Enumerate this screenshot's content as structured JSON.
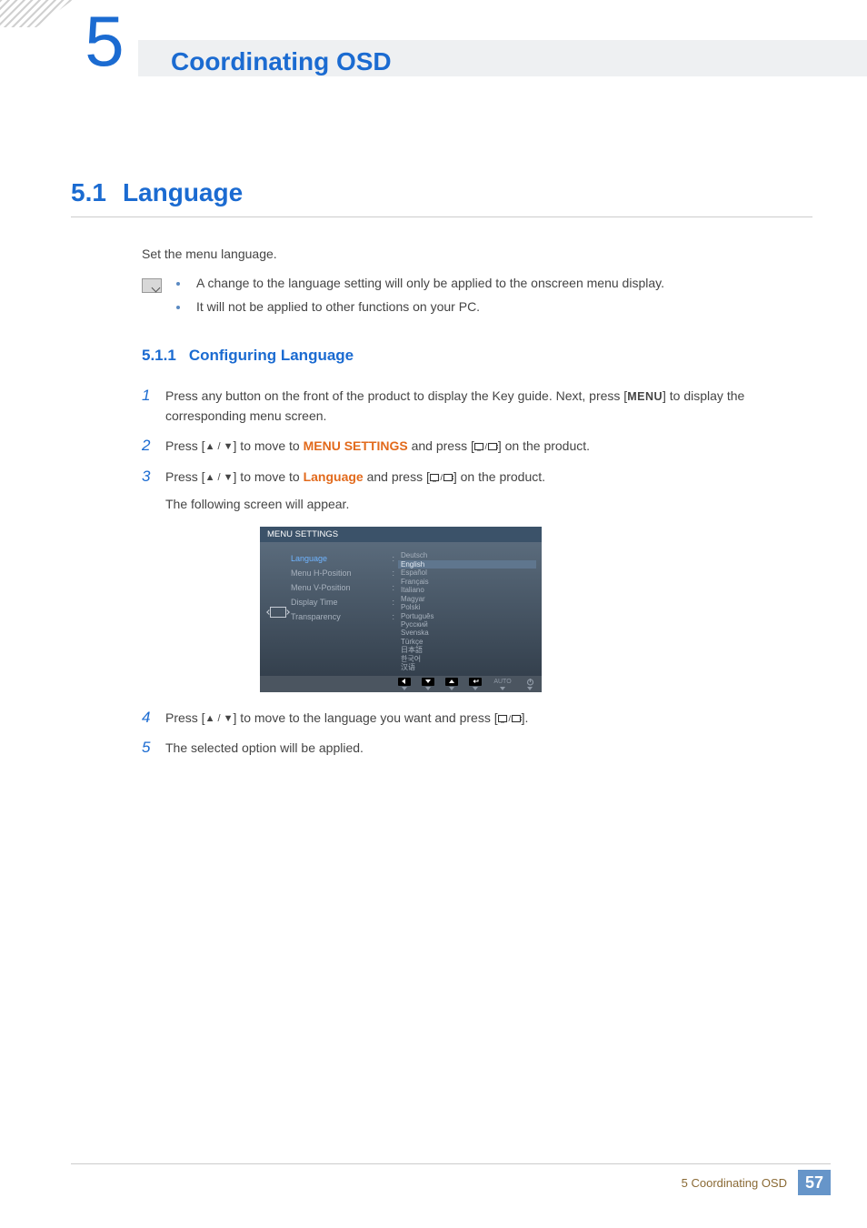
{
  "chapter": {
    "number": "5",
    "title": "Coordinating OSD"
  },
  "section": {
    "number": "5.1",
    "title": "Language"
  },
  "intro": "Set the menu language.",
  "notes": [
    "A change to the language setting will only be applied to the onscreen menu display.",
    "It will not be applied to other functions on your PC."
  ],
  "subsection": {
    "number": "5.1.1",
    "title": "Configuring Language"
  },
  "steps": {
    "s1": {
      "pre": "Press any button on the front of the product to display the Key guide. Next, press [",
      "menu": "MENU",
      "post": "] to display the corresponding menu screen."
    },
    "s2": {
      "pre": "Press [",
      "mid1": "] to move to ",
      "hl": "MENU SETTINGS",
      "mid2": " and press [",
      "post": "] on the product."
    },
    "s3": {
      "pre": "Press [",
      "mid1": "] to move to ",
      "hl": "Language",
      "mid2": " and press [",
      "post": "] on the product.",
      "sub": "The following screen will appear."
    },
    "s4": {
      "pre": "Press [",
      "mid1": "] to move to the language you want and press [",
      "post": "]."
    },
    "s5": "The selected option will be applied."
  },
  "osd": {
    "title": "MENU SETTINGS",
    "items": [
      "Language",
      "Menu H-Position",
      "Menu V-Position",
      "Display Time",
      "Transparency"
    ],
    "selected_item_index": 0,
    "languages": [
      "Deutsch",
      "English",
      "Español",
      "Français",
      "Italiano",
      "Magyar",
      "Polski",
      "Português",
      "Русский",
      "Svenska",
      "Türkçe",
      "日本語",
      "한국어",
      "汉语"
    ],
    "selected_lang_index": 1,
    "hint_auto": "AUTO"
  },
  "footer": {
    "text": "5 Coordinating OSD",
    "page": "57"
  }
}
